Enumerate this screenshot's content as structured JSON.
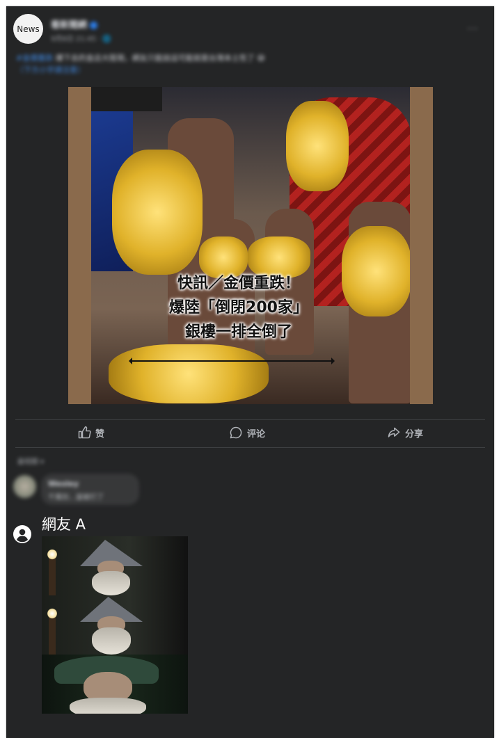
{
  "post": {
    "avatar_text": "News",
    "author": "看新聞網",
    "meta": "9月8日 21:45 · 🌐",
    "more": "···",
    "caption": {
      "hashtag": "#金價重跌",
      "text": " 爆下去的金店大陸現，網友只能說這可能就是台灣本土性了 😅",
      "link": "（下方小字請注意）"
    },
    "image": {
      "headline_lines": [
        "快訊／金價重跌！",
        "爆陸「倒閉200家」",
        "銀樓一排全倒了"
      ]
    },
    "actions": {
      "like": "赞",
      "comment": "评论",
      "share": "分享"
    },
    "sort_label": "最相關 ▾"
  },
  "comments": [
    {
      "name": "Wesley",
      "text": "千萬別…當被打了"
    },
    {
      "name": "網友 A"
    }
  ],
  "colors": {
    "card_bg": "#242526",
    "link_blue": "#4599ff",
    "text_secondary": "#b0b3b8"
  }
}
